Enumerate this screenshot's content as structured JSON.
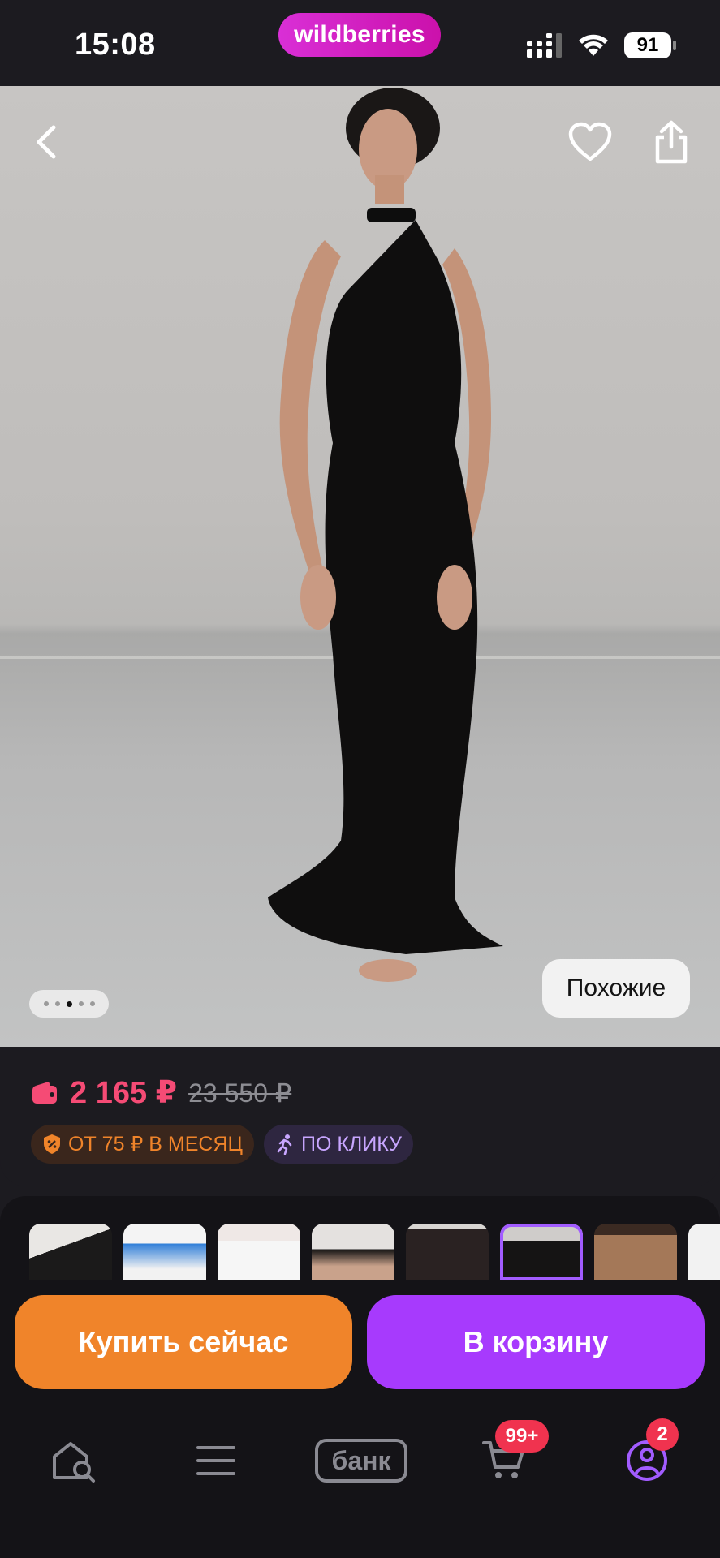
{
  "status_bar": {
    "time": "15:08",
    "brand": "wildberries",
    "battery": "91",
    "icons": [
      "signal-icon",
      "wifi-icon",
      "battery-icon"
    ]
  },
  "photo": {
    "icons": [
      "back-icon",
      "heart-icon",
      "share-icon"
    ],
    "pagination": {
      "count": 5,
      "active_index": 2
    },
    "similar_label": "Похожие"
  },
  "price": {
    "wallet_icon": "wallet-icon",
    "current": "2 165 ₽",
    "old": "23 550 ₽",
    "current_color": "#f54b75"
  },
  "badges": {
    "installment": "ОТ 75 ₽ В МЕСЯЦ",
    "one_click": "ПО КЛИКУ"
  },
  "thumbnails": {
    "count": 8,
    "selected_index": 5
  },
  "actions": {
    "buy_now": "Купить сейчас",
    "add_to_cart": "В корзину",
    "buy_color": "#f0842a",
    "cart_color": "#a73afd"
  },
  "tab_bar": {
    "items": [
      "home-search-icon",
      "catalog-menu-icon",
      "bank-tab",
      "cart-icon",
      "profile-icon"
    ],
    "bank_label": "банк",
    "cart_badge": "99+",
    "profile_badge": "2"
  }
}
